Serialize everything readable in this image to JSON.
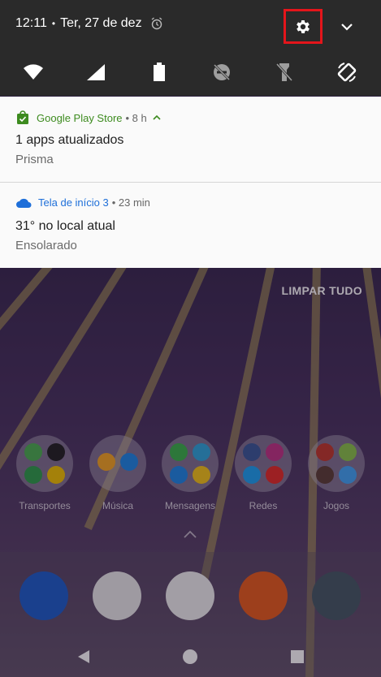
{
  "status_bar": {
    "time": "12:11",
    "separator": "•",
    "date": "Ter, 27 de dez"
  },
  "quick_tiles": [
    "wifi",
    "cell-signal",
    "battery",
    "do-not-disturb-off",
    "flashlight-off",
    "auto-rotate"
  ],
  "notifications": [
    {
      "app": "Google Play Store",
      "time": "• 8 h",
      "title": "1 apps atualizados",
      "text": "Prisma",
      "accent": "#3d8b1f"
    },
    {
      "app": "Tela de início 3",
      "time": "• 23 min",
      "title": "31° no local atual",
      "text": "Ensolarado",
      "accent": "#1e6fd9"
    }
  ],
  "home": {
    "clear_all": "LIMPAR TUDO",
    "folders": [
      "Transportes",
      "Música",
      "Mensagens",
      "Redes",
      "Jogos"
    ],
    "dock": [
      "phone",
      "photos",
      "gmail",
      "firefox",
      "camera"
    ]
  },
  "colors": {
    "panel": "#2a2a2a",
    "highlight": "#e4151b"
  }
}
